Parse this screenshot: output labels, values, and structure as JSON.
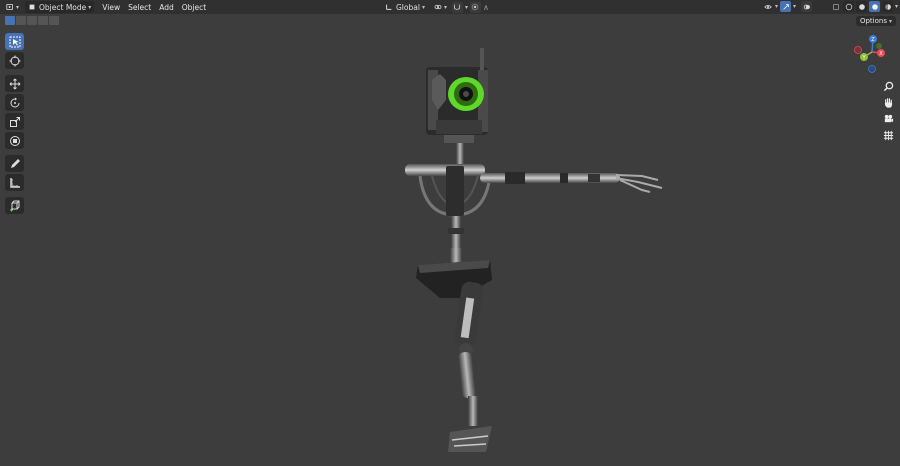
{
  "header": {
    "editor_type_icon": "3d-viewport-icon",
    "mode_label": "Object Mode",
    "menus": [
      "View",
      "Select",
      "Add",
      "Object"
    ],
    "transform_orientation": "Global",
    "options_label": "Options"
  },
  "toolbar": {
    "tools": [
      "select-box",
      "cursor",
      "move",
      "rotate",
      "scale",
      "transform",
      "annotate",
      "measure",
      "add-cube"
    ],
    "active_tool": "select-box"
  },
  "gizmo": {
    "axes": [
      "X",
      "Y",
      "Z"
    ],
    "colors": {
      "x": "#e94b55",
      "y": "#8fc23c",
      "z": "#3d7ed6"
    }
  },
  "nav_buttons": [
    "zoom-icon",
    "hand-pan-icon",
    "camera-icon",
    "grid-view-icon"
  ],
  "colors": {
    "viewport_bg": "#3d3d3d",
    "header_bg": "#303030",
    "accent": "#4772b3",
    "eye_glow": "#5ed82a"
  }
}
